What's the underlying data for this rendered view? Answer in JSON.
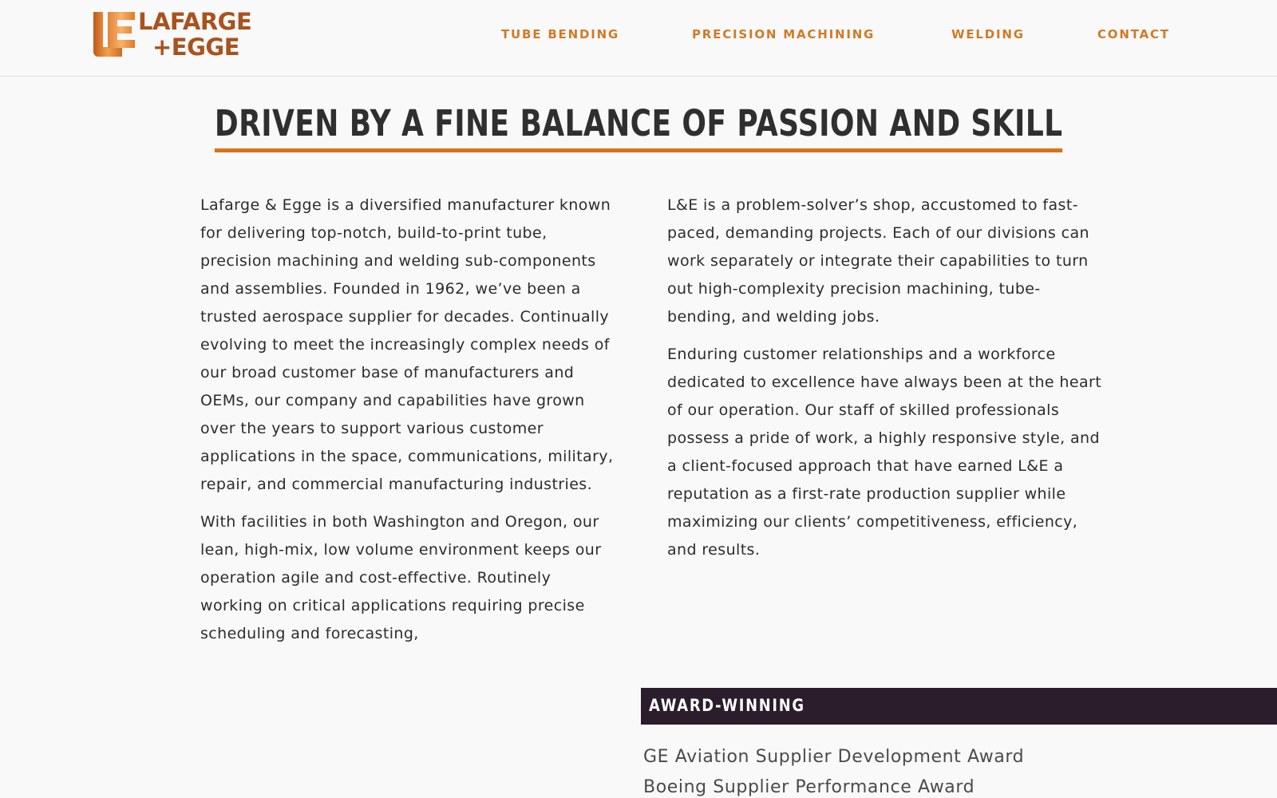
{
  "header": {
    "logo": {
      "line1": "LAFARGE",
      "line2": "+EGGE"
    },
    "nav": [
      {
        "label": "TUBE BENDING"
      },
      {
        "label": "PRECISION MACHINING"
      },
      {
        "label": "WELDING"
      },
      {
        "label": "CONTACT"
      }
    ]
  },
  "main": {
    "headline": "DRIVEN BY A FINE BALANCE OF PASSION AND SKILL",
    "left_column": [
      "Lafarge & Egge is a diversified manufacturer known for delivering top-notch, build-to-print tube, precision machining and welding sub-components and assemblies. Founded in 1962, we’ve been a trusted aerospace supplier for decades. Continually evolving to meet the increasingly complex needs of our broad customer base of manufacturers and OEMs, our company and capabilities have grown over the years to support various customer applications in the space, communications, military, repair, and commercial manufacturing industries.",
      "With facilities in both Washington and Oregon, our lean, high-mix, low volume environment keeps our operation agile and cost-effective. Routinely working on critical applications requiring precise scheduling and forecasting,"
    ],
    "right_column": [
      "L&E is a problem-solver’s shop, accustomed to fast-paced, demanding projects. Each of our divisions can work separately or integrate their capabilities to turn out high-complexity precision machining, tube-bending, and welding jobs.",
      "Enduring customer relationships and a workforce dedicated to excellence have always been at the heart of our operation. Our staff of skilled professionals possess a pride of work, a highly responsive style, and a client-focused approach that have earned L&E a reputation as a first-rate production supplier while maximizing our clients’ competitiveness, efficiency, and results."
    ],
    "award": {
      "heading": "AWARD-WINNING",
      "items": [
        "GE Aviation Supplier Development Award",
        "Boeing Supplier Performance Award"
      ]
    }
  },
  "colors": {
    "brand_orange": "#d17a28",
    "logo_brown": "#a9521e",
    "headline_underline": "#d6731f",
    "award_bar": "#2c1d2c",
    "text": "#2c2c2c",
    "background": "#f9f9f9"
  }
}
